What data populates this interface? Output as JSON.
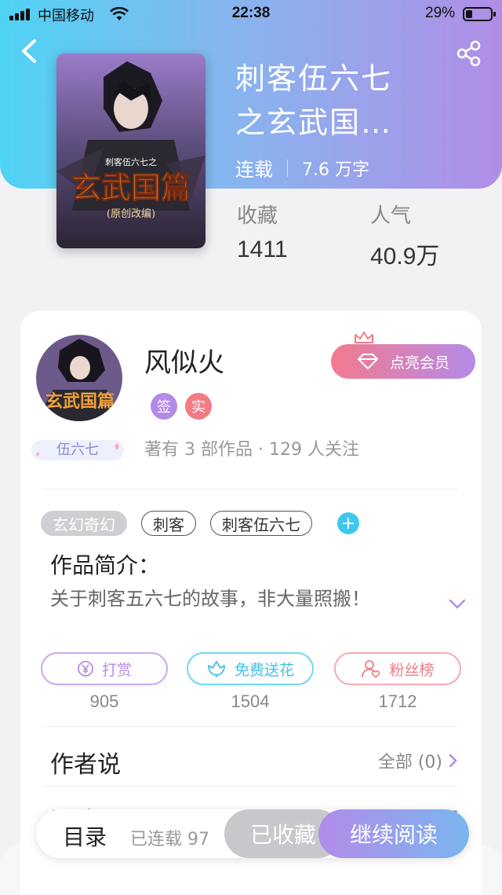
{
  "status_bar": {
    "carrier": "中国移动",
    "time": "22:38",
    "battery": "29%"
  },
  "book": {
    "title": "刺客伍六七\n之玄武国…",
    "status": "连载",
    "word_count": "7.6 万字",
    "cover_text_top": "刺客伍六七之",
    "cover_text_main": "玄武国篇",
    "cover_text_sub": "(原创改编)"
  },
  "stats": [
    {
      "label": "收藏",
      "value": "1411"
    },
    {
      "label": "人气",
      "value": "40.9万"
    }
  ],
  "author": {
    "name": "风似火",
    "tags": [
      "签",
      "实"
    ],
    "info": "著有 3 部作品 · 129 人关注",
    "nickname_badge": "伍六七",
    "vip_button": "点亮会员"
  },
  "tags": [
    "玄幻奇幻",
    "刺客",
    "刺客伍六七"
  ],
  "intro": {
    "title": "作品简介：",
    "text": "关于刺客五六七的故事，非大量照搬！"
  },
  "actions": [
    {
      "label": "打赏",
      "count": "905",
      "icon": "yen-icon"
    },
    {
      "label": "免费送花",
      "count": "1504",
      "icon": "flower-icon"
    },
    {
      "label": "粉丝榜",
      "count": "1712",
      "icon": "fan-icon"
    }
  ],
  "author_says": {
    "title": "作者说",
    "right": "全部 (0)"
  },
  "comments": {
    "title": "评论",
    "right": "全部"
  },
  "bottom_bar": {
    "toc": "目录",
    "chapters": "已连载 97",
    "collected": "已收藏",
    "continue": "继续阅读"
  },
  "colors": {
    "hero_start": "#4fd3f4",
    "hero_end": "#b08ee6",
    "accent_purple": "#b48ae8",
    "accent_pink": "#f27c86",
    "accent_blue": "#3fc8ef"
  }
}
